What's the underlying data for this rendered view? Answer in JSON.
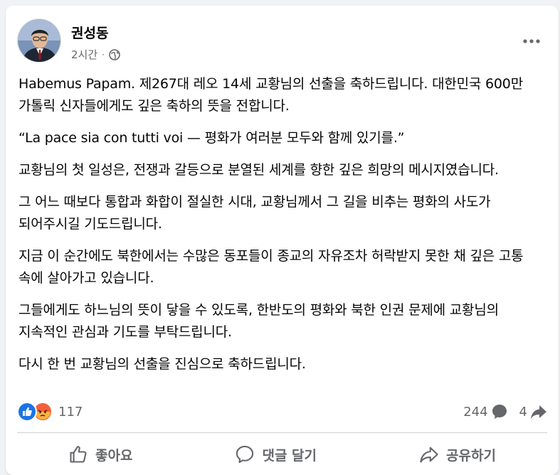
{
  "author": {
    "name": "권성동",
    "time": "2시간",
    "separator": "·"
  },
  "post": {
    "paragraphs": [
      "Habemus Papam. 제267대 레오 14세 교황님의 선출을 축하드립니다. 대한민국 600만 가톨릭 신자들에게도 깊은 축하의 뜻을 전합니다.",
      "“La pace sia con tutti voi — 평화가 여러분 모두와 함께 있기를.”",
      "교황님의 첫 일성은, 전쟁과 갈등으로 분열된 세계를 향한 깊은 희망의 메시지였습니다.",
      "그 어느 때보다 통합과 화합이 절실한 시대, 교황님께서 그 길을 비추는 평화의 사도가 되어주시길 기도드립니다.",
      "지금 이 순간에도 북한에서는 수많은 동포들이 종교의 자유조차 허락받지 못한 채 깊은 고통 속에 살아가고 있습니다.",
      "그들에게도 하느님의 뜻이 닿을 수 있도록, 한반도의 평화와 북한 인권 문제에 교황님의 지속적인 관심과 기도를 부탁드립니다.",
      "다시 한 번 교황님의 선출을 진심으로 축하드립니다."
    ]
  },
  "stats": {
    "reactions_count": "117",
    "comments_count": "244",
    "shares_count": "4"
  },
  "actions": {
    "like": "좋아요",
    "comment": "댓글 달기",
    "share": "공유하기"
  },
  "colors": {
    "like_blue": "#1b74e4",
    "angry_orange": "#f0603c",
    "secondary_text": "#65676b"
  }
}
